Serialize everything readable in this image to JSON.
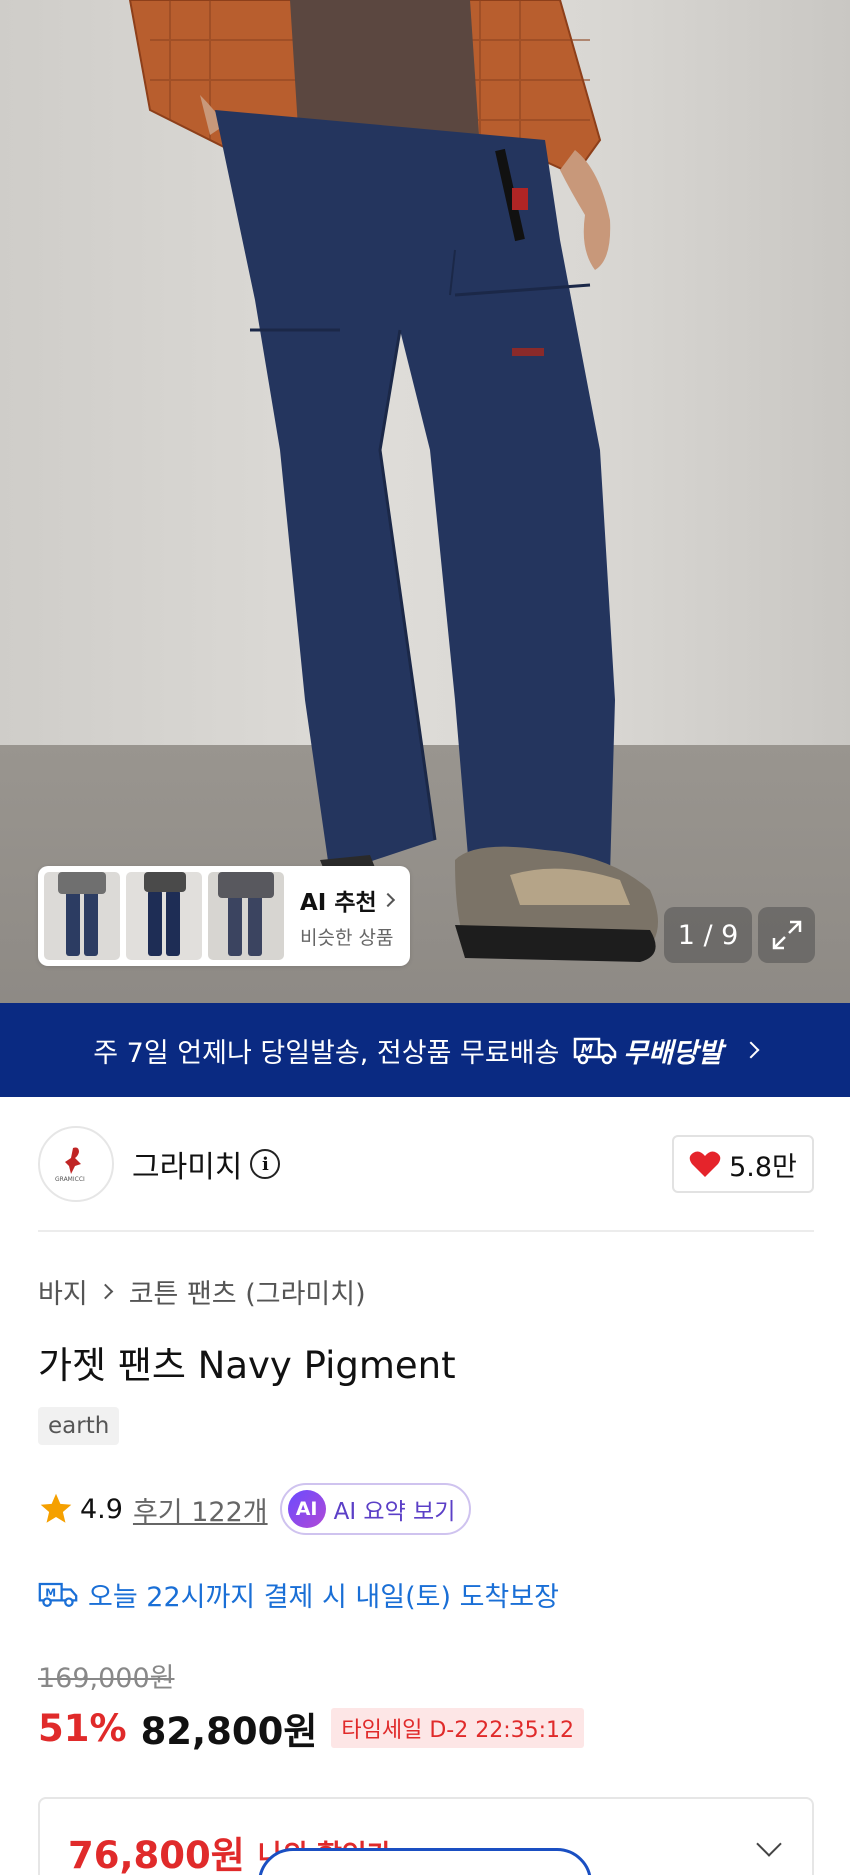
{
  "hero": {
    "ai_card": {
      "title": "AI 추천",
      "subtitle": "비슷한 상품"
    },
    "image_counter": "1 / 9"
  },
  "banner": {
    "text": "주 7일 언제나 당일발송, 전상품 무료배송",
    "brand_label": "무배당발"
  },
  "brand": {
    "logo_text": "GRAMICCI",
    "name": "그라미치",
    "likes": "5.8만"
  },
  "product": {
    "breadcrumb": [
      "바지",
      "코튼 팬츠 (그라미치)"
    ],
    "title": "가젯 팬츠 Navy Pigment",
    "tag": "earth",
    "rating": "4.9",
    "reviews": "후기 122개",
    "ai_badge": "AI",
    "ai_summary": "AI 요약 보기",
    "delivery": "오늘 22시까지 결제 시 내일(토) 도착보장",
    "original_price": "169,000원",
    "discount_rate": "51%",
    "sale_price": "82,800원",
    "timesale": "타임세일 D-2 22:35:12",
    "my_price": "76,800원",
    "my_discount_label": "나의 할인가"
  },
  "colors": {
    "banner_bg": "#0a2a82",
    "sale_red": "#e02a2a",
    "delivery_blue": "#1a6fd6",
    "ai_purple": "#5b3fc7"
  },
  "icons": [
    "chevron-right-icon",
    "expand-icon",
    "delivery-truck-icon",
    "info-icon",
    "heart-icon",
    "star-icon",
    "chevron-down-icon"
  ]
}
